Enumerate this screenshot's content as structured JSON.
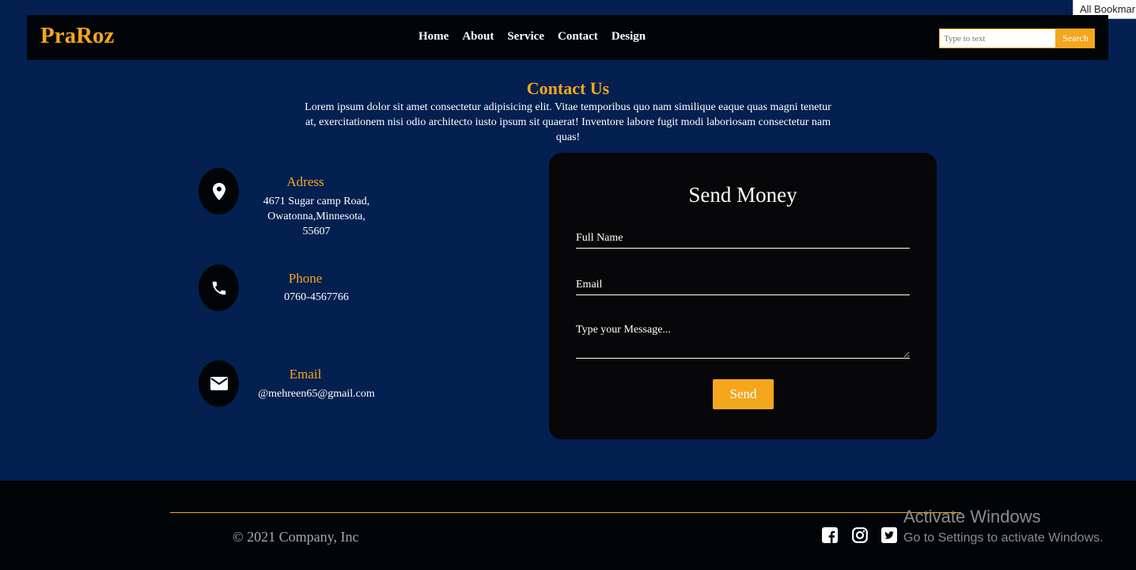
{
  "browser": {
    "bookmarks_label": "All Bookmarks"
  },
  "nav": {
    "brand": "PraRoz",
    "links": [
      "Home",
      "About",
      "Service",
      "Contact",
      "Design"
    ],
    "search_placeholder": "Type to text",
    "search_button": "Search"
  },
  "contact": {
    "title": "Contact Us",
    "description": "Lorem ipsum dolor sit amet consectetur adipisicing elit. Vitae temporibus quo nam similique eaque quas magni tenetur at, exercitationem nisi odio architecto iusto ipsum sit quaerat! Inventore labore fugit modi laboriosam consectetur nam quas!"
  },
  "info": {
    "address": {
      "label": "Adress",
      "lines": [
        "4671 Sugar camp Road,",
        "Owatonna,Minnesota,",
        "55607"
      ],
      "icon": "map-marker-icon"
    },
    "phone": {
      "label": "Phone",
      "value": "0760-4567766",
      "icon": "phone-icon"
    },
    "email": {
      "label": "Email",
      "value": "@mehreen65@gmail.com",
      "icon": "envelope-icon"
    }
  },
  "form": {
    "title": "Send Money",
    "full_name_placeholder": "Full Name",
    "email_placeholder": "Email",
    "message_placeholder": "Type your Message...",
    "send_label": "Send"
  },
  "footer": {
    "copyright": "© 2021 Company, Inc",
    "socials": [
      "facebook-icon",
      "instagram-icon",
      "twitter-icon"
    ]
  },
  "overlay": {
    "title": "Activate Windows",
    "subtitle": "Go to Settings to activate Windows."
  },
  "colors": {
    "background": "#032050",
    "accent": "#f4a71d",
    "dark": "#020508",
    "card": "#070608"
  }
}
